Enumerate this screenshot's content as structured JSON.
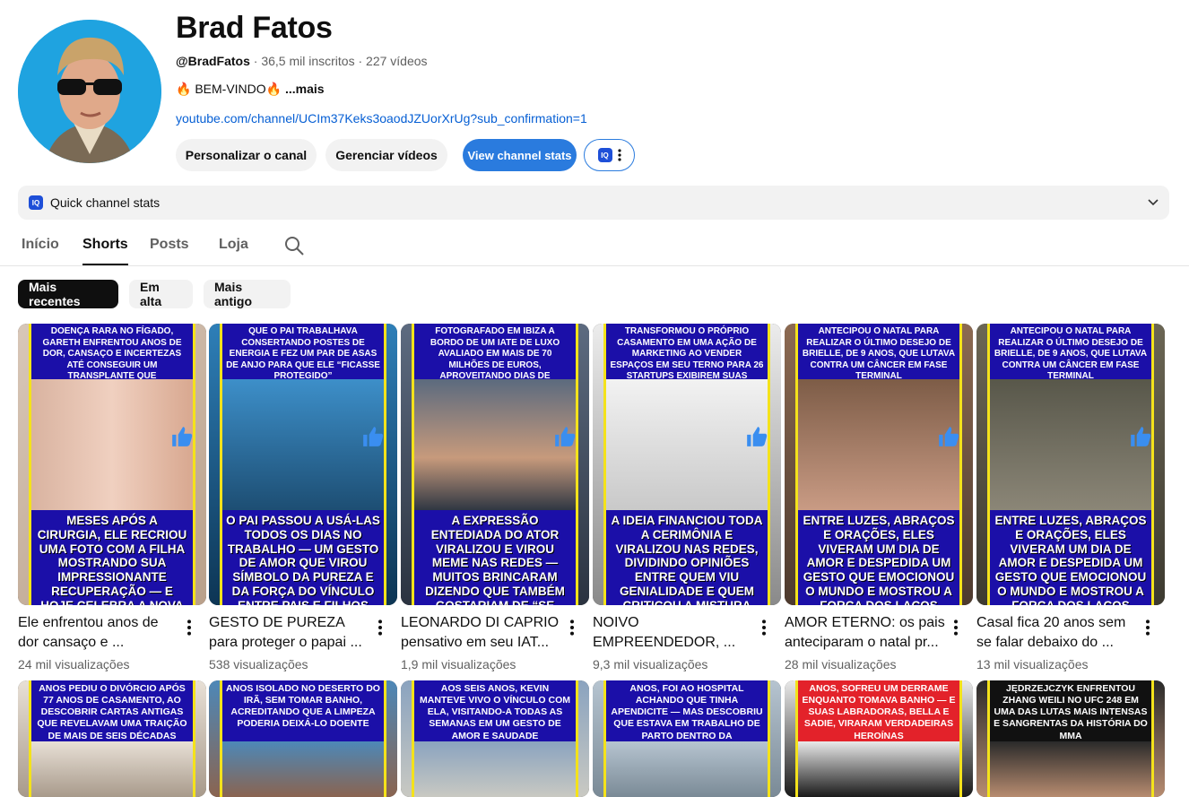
{
  "channel": {
    "name": "Brad Fatos",
    "handle": "@BradFatos",
    "stats": "· 36,5 mil inscritos · 227 vídeos",
    "description": "🔥 BEM-VINDO🔥",
    "more_label": "...mais",
    "link": "youtube.com/channel/UCIm37Keks3oaodJZUorXrUg?sub_confirmation=1"
  },
  "buttons": {
    "customize": "Personalizar o canal",
    "manage": "Gerenciar vídeos",
    "view_stats": "View channel stats",
    "iq_badge": "IQ"
  },
  "quick_stats": {
    "label": "Quick channel stats",
    "badge": "IQ"
  },
  "tabs": [
    {
      "label": "Início"
    },
    {
      "label": "Shorts"
    },
    {
      "label": "Posts"
    },
    {
      "label": "Loja"
    }
  ],
  "chips": [
    {
      "label": "Mais recentes"
    },
    {
      "label": "Em alta"
    },
    {
      "label": "Mais antigo"
    }
  ],
  "shorts": [
    {
      "title": "Ele enfrentou anos de dor cansaço e ...",
      "views": "24 mil visualizações",
      "top_caption": "DOENÇA RARA NO FÍGADO, GARETH ENFRENTOU ANOS DE DOR, CANSAÇO E INCERTEZAS ATÉ CONSEGUIR UM TRANSPLANTE QUE TRANSFORMOU SUA VIDA",
      "bottom_caption": "MESES APÓS A CIRURGIA, ELE RECRIOU UMA FOTO COM A FILHA MOSTRANDO SUA IMPRESSIONANTE RECUPERAÇÃO — E HOJE CELEBRA A NOVA CHANCE DE VIVER, EM GRATIDÃO AO"
    },
    {
      "title": "GESTO DE PUREZA para proteger o papai ...",
      "views": "538 visualizações",
      "top_caption": "QUE O PAI TRABALHAVA CONSERTANDO POSTES DE ENERGIA E FEZ UM PAR DE ASAS DE ANJO PARA QUE ELE “FICASSE PROTEGIDO”",
      "bottom_caption": "O PAI PASSOU A USÁ-LAS TODOS OS DIAS NO TRABALHO — UM GESTO DE AMOR QUE VIROU SÍMBOLO DA PUREZA E DA FORÇA DO VÍNCULO ENTRE PAIS E FILHOS"
    },
    {
      "title": "LEONARDO DI CAPRIO pensativo em seu IAT...",
      "views": "1,9 mil visualizações",
      "top_caption": "FOTOGRAFADO EM IBIZA A BORDO DE UM IATE DE LUXO AVALIADO EM MAIS DE 70 MILHÕES DE EUROS, APROVEITANDO DIAS DE DESCANSO NO MEDITERRÂNEO",
      "bottom_caption": "A EXPRESSÃO ENTEDIADA DO ATOR VIRALIZOU E VIROU MEME NAS REDES — MUITOS BRINCARAM DIZENDO QUE TAMBÉM GOSTARIAM DE “SE ENTEDIAR” EM UM BARCO MILIONÁRIO SOB O SOL"
    },
    {
      "title": "NOIVO EMPREENDEDOR, ...",
      "views": "9,3 mil visualizações",
      "top_caption": "TRANSFORMOU O PRÓPRIO CASAMENTO EM UMA AÇÃO DE MARKETING AO VENDER ESPAÇOS EM SEU TERNO PARA 26 STARTUPS EXIBIREM SUAS MARCAS",
      "bottom_caption": "A IDEIA FINANCIOU TODA A CERIMÔNIA E VIRALIZOU NAS REDES, DIVIDINDO OPINIÕES ENTRE QUEM VIU GENIALIDADE E QUEM CRITICOU A MISTURA ENTRE AMOR E NEGÓCIOS"
    },
    {
      "title": "AMOR ETERNO: os pais anteciparam o natal pr...",
      "views": "28 mil visualizações",
      "top_caption": "ANTECIPOU O NATAL PARA REALIZAR O ÚLTIMO DESEJO DE BRIELLE, DE 9 ANOS, QUE LUTAVA CONTRA UM CÂNCER EM FASE TERMINAL",
      "bottom_caption": "ENTRE LUZES, ABRAÇOS E ORAÇÕES, ELES VIVERAM UM DIA DE AMOR E DESPEDIDA UM GESTO QUE EMOCIONOU O MUNDO E MOSTROU A FORÇA DOS LAÇOS FAMILIARES"
    },
    {
      "title": "Casal fica 20 anos sem se falar debaixo do ...",
      "views": "13 mil visualizações",
      "top_caption": "ANTECIPOU O NATAL PARA REALIZAR O ÚLTIMO DESEJO DE BRIELLE, DE 9 ANOS, QUE LUTAVA CONTRA UM CÂNCER EM FASE TERMINAL",
      "bottom_caption": "ENTRE LUZES, ABRAÇOS E ORAÇÕES, ELES VIVERAM UM DIA DE AMOR E DESPEDIDA UM GESTO QUE EMOCIONOU O MUNDO E MOSTROU A FORÇA DOS LAÇOS FAMILIARES"
    }
  ],
  "shorts_row2": [
    {
      "top_caption": "ANOS PEDIU O DIVÓRCIO APÓS 77 ANOS DE CASAMENTO, AO DESCOBRIR CARTAS ANTIGAS QUE REVELAVAM UMA TRAIÇÃO DE MAIS DE SEIS DÉCADAS ATRÁS"
    },
    {
      "top_caption": "ANOS ISOLADO NO DESERTO DO IRÃ, SEM TOMAR BANHO, ACREDITANDO QUE A LIMPEZA PODERIA DEIXÁ-LO DOENTE"
    },
    {
      "top_caption": "AOS SEIS ANOS, KEVIN MANTEVE VIVO O VÍNCULO COM ELA, VISITANDO-A TODAS AS SEMANAS EM UM GESTO DE AMOR E SAUDADE"
    },
    {
      "top_caption": "ANOS, FOI AO HOSPITAL ACHANDO QUE TINHA APENDICITE — MAS DESCOBRIU QUE ESTAVA EM TRABALHO DE PARTO DENTRO DA AMBULÂNCIA"
    },
    {
      "top_caption": "ANOS, SOFREU UM DERRAME ENQUANTO TOMAVA BANHO — E SUAS LABRADORAS, BELLA E SADIE, VIRARAM VERDADEIRAS HEROÍNAS"
    },
    {
      "top_caption": "JĘDRZEJCZYK ENFRENTOU ZHANG WEILI NO UFC 248 EM UMA DAS LUTAS MAIS INTENSAS E SANGRENTAS DA HISTÓRIA DO MMA"
    }
  ],
  "colors": {
    "accent_blue": "#2a7bde",
    "link": "#065fd4",
    "caption_bg": "#1b0fa8",
    "caption_border": "#f4e21b",
    "like_blue": "#3a8ef0"
  }
}
